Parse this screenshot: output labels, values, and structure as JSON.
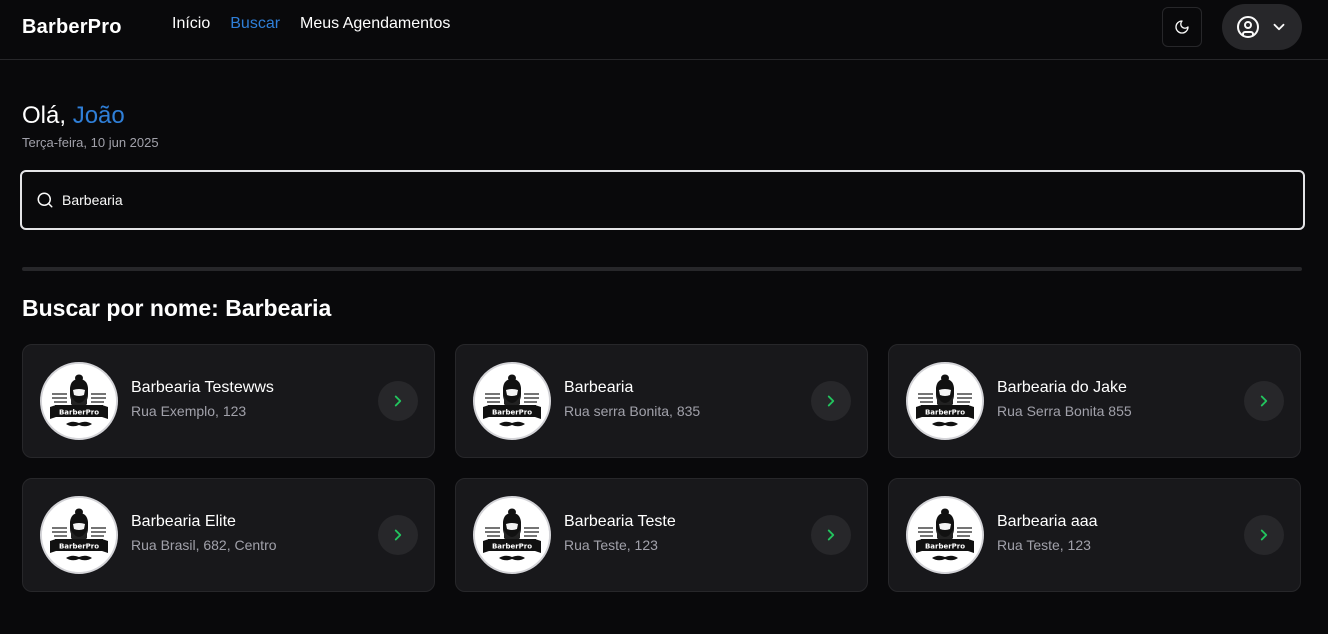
{
  "header": {
    "logo": "BarberPro",
    "nav": [
      {
        "label": "Início",
        "active": false
      },
      {
        "label": "Buscar",
        "active": true
      },
      {
        "label": "Meus Agendamentos",
        "active": false
      }
    ],
    "theme_icon": "moon-icon",
    "user_icon": "user-circle-icon",
    "user_menu_icon": "chevron-down-icon"
  },
  "greeting": {
    "prefix": "Olá,",
    "name": "João",
    "date": "Terça-feira, 10 jun 2025"
  },
  "search": {
    "value": "Barbearia",
    "icon": "search-icon"
  },
  "results": {
    "title": "Buscar por nome: Barbearia",
    "items": [
      {
        "name": "Barbearia Testewws",
        "address": "Rua Exemplo, 123"
      },
      {
        "name": "Barbearia",
        "address": "Rua serra Bonita, 835"
      },
      {
        "name": "Barbearia do Jake",
        "address": "Rua Serra Bonita 855"
      },
      {
        "name": "Barbearia Elite",
        "address": "Rua Brasil, 682, Centro"
      },
      {
        "name": "Barbearia Teste",
        "address": "Rua Teste, 123"
      },
      {
        "name": "Barbearia aaa",
        "address": "Rua Teste, 123"
      }
    ],
    "logo_text": "BarberPro"
  },
  "colors": {
    "accent": "#2f7fd8",
    "arrow": "#22c55e",
    "background": "#09090b",
    "card": "#18181b"
  }
}
